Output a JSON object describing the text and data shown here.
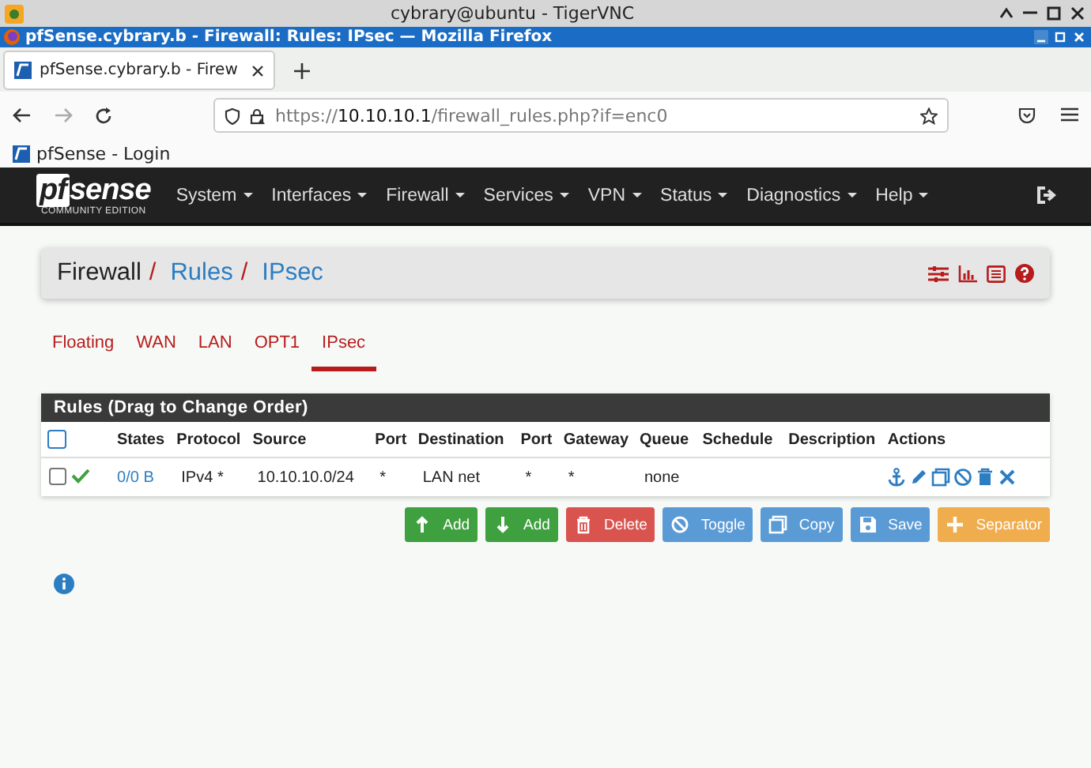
{
  "vnc_window": {
    "title": "cybrary@ubuntu - TigerVNC"
  },
  "browser": {
    "title": "pfSense.cybrary.b - Firewall: Rules: IPsec — Mozilla Firefox",
    "tabs": [
      {
        "label": "pfSense.cybrary.b - Firew",
        "selected": true
      }
    ],
    "url": {
      "scheme": "https://",
      "host": "10.10.10.1",
      "path": "/firewall_rules.php?if=enc0"
    },
    "bookmarks": [
      {
        "label": "pfSense - Login"
      }
    ]
  },
  "navbar": {
    "logo": "sense",
    "logo_prefix": "pf",
    "edition": "COMMUNITY EDITION",
    "menu": [
      {
        "label": "System"
      },
      {
        "label": "Interfaces"
      },
      {
        "label": "Firewall"
      },
      {
        "label": "Services"
      },
      {
        "label": "VPN"
      },
      {
        "label": "Status"
      },
      {
        "label": "Diagnostics"
      },
      {
        "label": "Help"
      }
    ]
  },
  "breadcrumb_separator": "/",
  "breadcrumb": [
    {
      "label": "Firewall",
      "kind": "plain"
    },
    {
      "label": "Rules",
      "kind": "link"
    },
    {
      "label": "IPsec",
      "kind": "link"
    }
  ],
  "interface_tabs": [
    {
      "label": "Floating",
      "selected": false
    },
    {
      "label": "WAN",
      "selected": false
    },
    {
      "label": "LAN",
      "selected": false
    },
    {
      "label": "OPT1",
      "selected": false
    },
    {
      "label": "IPsec",
      "selected": true
    }
  ],
  "rules": {
    "title": "Rules (Drag to Change Order)",
    "select_all_checked": false,
    "columns": [
      "States",
      "Protocol",
      "Source",
      "Port",
      "Destination",
      "Port",
      "Gateway",
      "Queue",
      "Schedule",
      "Description",
      "Actions"
    ],
    "rows": [
      {
        "checked": false,
        "enabled": true,
        "cells": [
          "0/0 B",
          "IPv4 *",
          "10.10.10.0/24",
          "*",
          "LAN net",
          "*",
          "*",
          "none"
        ]
      }
    ]
  },
  "buttons": [
    {
      "label": "Add",
      "kind": "add-top"
    },
    {
      "label": "Add",
      "kind": "add-bottom"
    },
    {
      "label": "Delete",
      "kind": "delete"
    },
    {
      "label": "Toggle",
      "kind": "toggle"
    },
    {
      "label": "Copy",
      "kind": "copy"
    },
    {
      "label": "Save",
      "kind": "save"
    },
    {
      "label": "Separator",
      "kind": "separator"
    }
  ]
}
